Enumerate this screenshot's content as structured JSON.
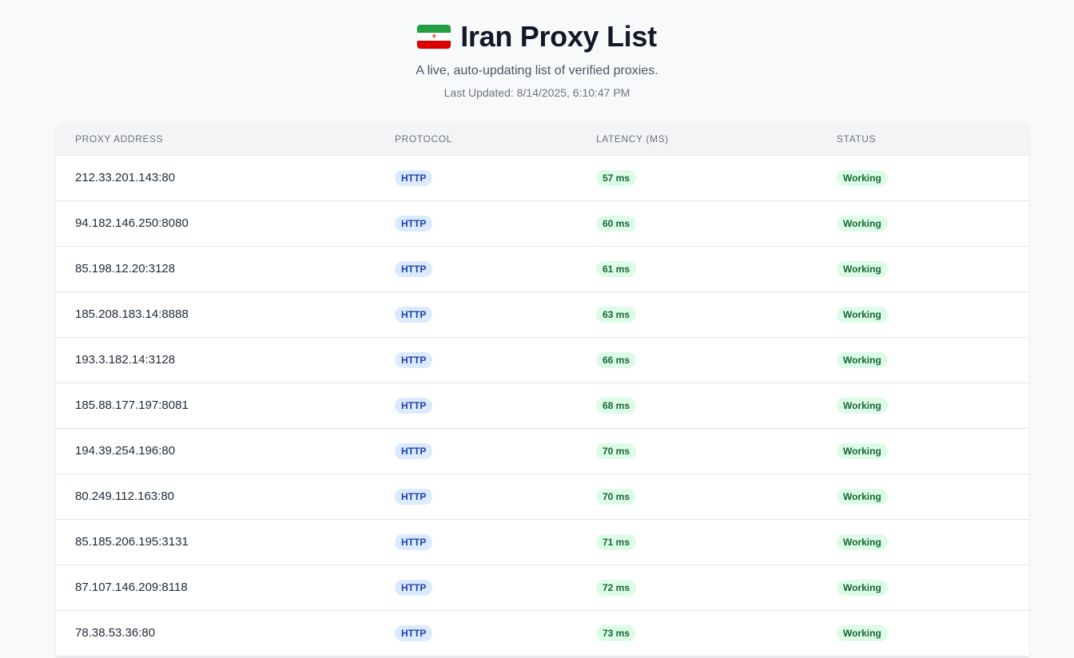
{
  "header": {
    "title": "Iran Proxy List",
    "subtitle": "A live, auto-updating list of verified proxies.",
    "last_updated": "Last Updated: 8/14/2025, 6:10:47 PM",
    "flag_icon": "iran-flag-icon"
  },
  "table": {
    "columns": [
      "Proxy Address",
      "Protocol",
      "Latency (ms)",
      "Status"
    ],
    "rows": [
      {
        "address": "212.33.201.143:80",
        "protocol": "HTTP",
        "latency": "57 ms",
        "status": "Working"
      },
      {
        "address": "94.182.146.250:8080",
        "protocol": "HTTP",
        "latency": "60 ms",
        "status": "Working"
      },
      {
        "address": "85.198.12.20:3128",
        "protocol": "HTTP",
        "latency": "61 ms",
        "status": "Working"
      },
      {
        "address": "185.208.183.14:8888",
        "protocol": "HTTP",
        "latency": "63 ms",
        "status": "Working"
      },
      {
        "address": "193.3.182.14:3128",
        "protocol": "HTTP",
        "latency": "66 ms",
        "status": "Working"
      },
      {
        "address": "185.88.177.197:8081",
        "protocol": "HTTP",
        "latency": "68 ms",
        "status": "Working"
      },
      {
        "address": "194.39.254.196:80",
        "protocol": "HTTP",
        "latency": "70 ms",
        "status": "Working"
      },
      {
        "address": "80.249.112.163:80",
        "protocol": "HTTP",
        "latency": "70 ms",
        "status": "Working"
      },
      {
        "address": "85.185.206.195:3131",
        "protocol": "HTTP",
        "latency": "71 ms",
        "status": "Working"
      },
      {
        "address": "87.107.146.209:8118",
        "protocol": "HTTP",
        "latency": "72 ms",
        "status": "Working"
      },
      {
        "address": "78.38.53.36:80",
        "protocol": "HTTP",
        "latency": "73 ms",
        "status": "Working"
      }
    ]
  },
  "colors": {
    "background": "#f8f9fb",
    "protocol_badge_bg": "#dbeafe",
    "protocol_badge_text": "#1e40af",
    "success_badge_bg": "#dcfce7",
    "success_badge_text": "#166534"
  }
}
